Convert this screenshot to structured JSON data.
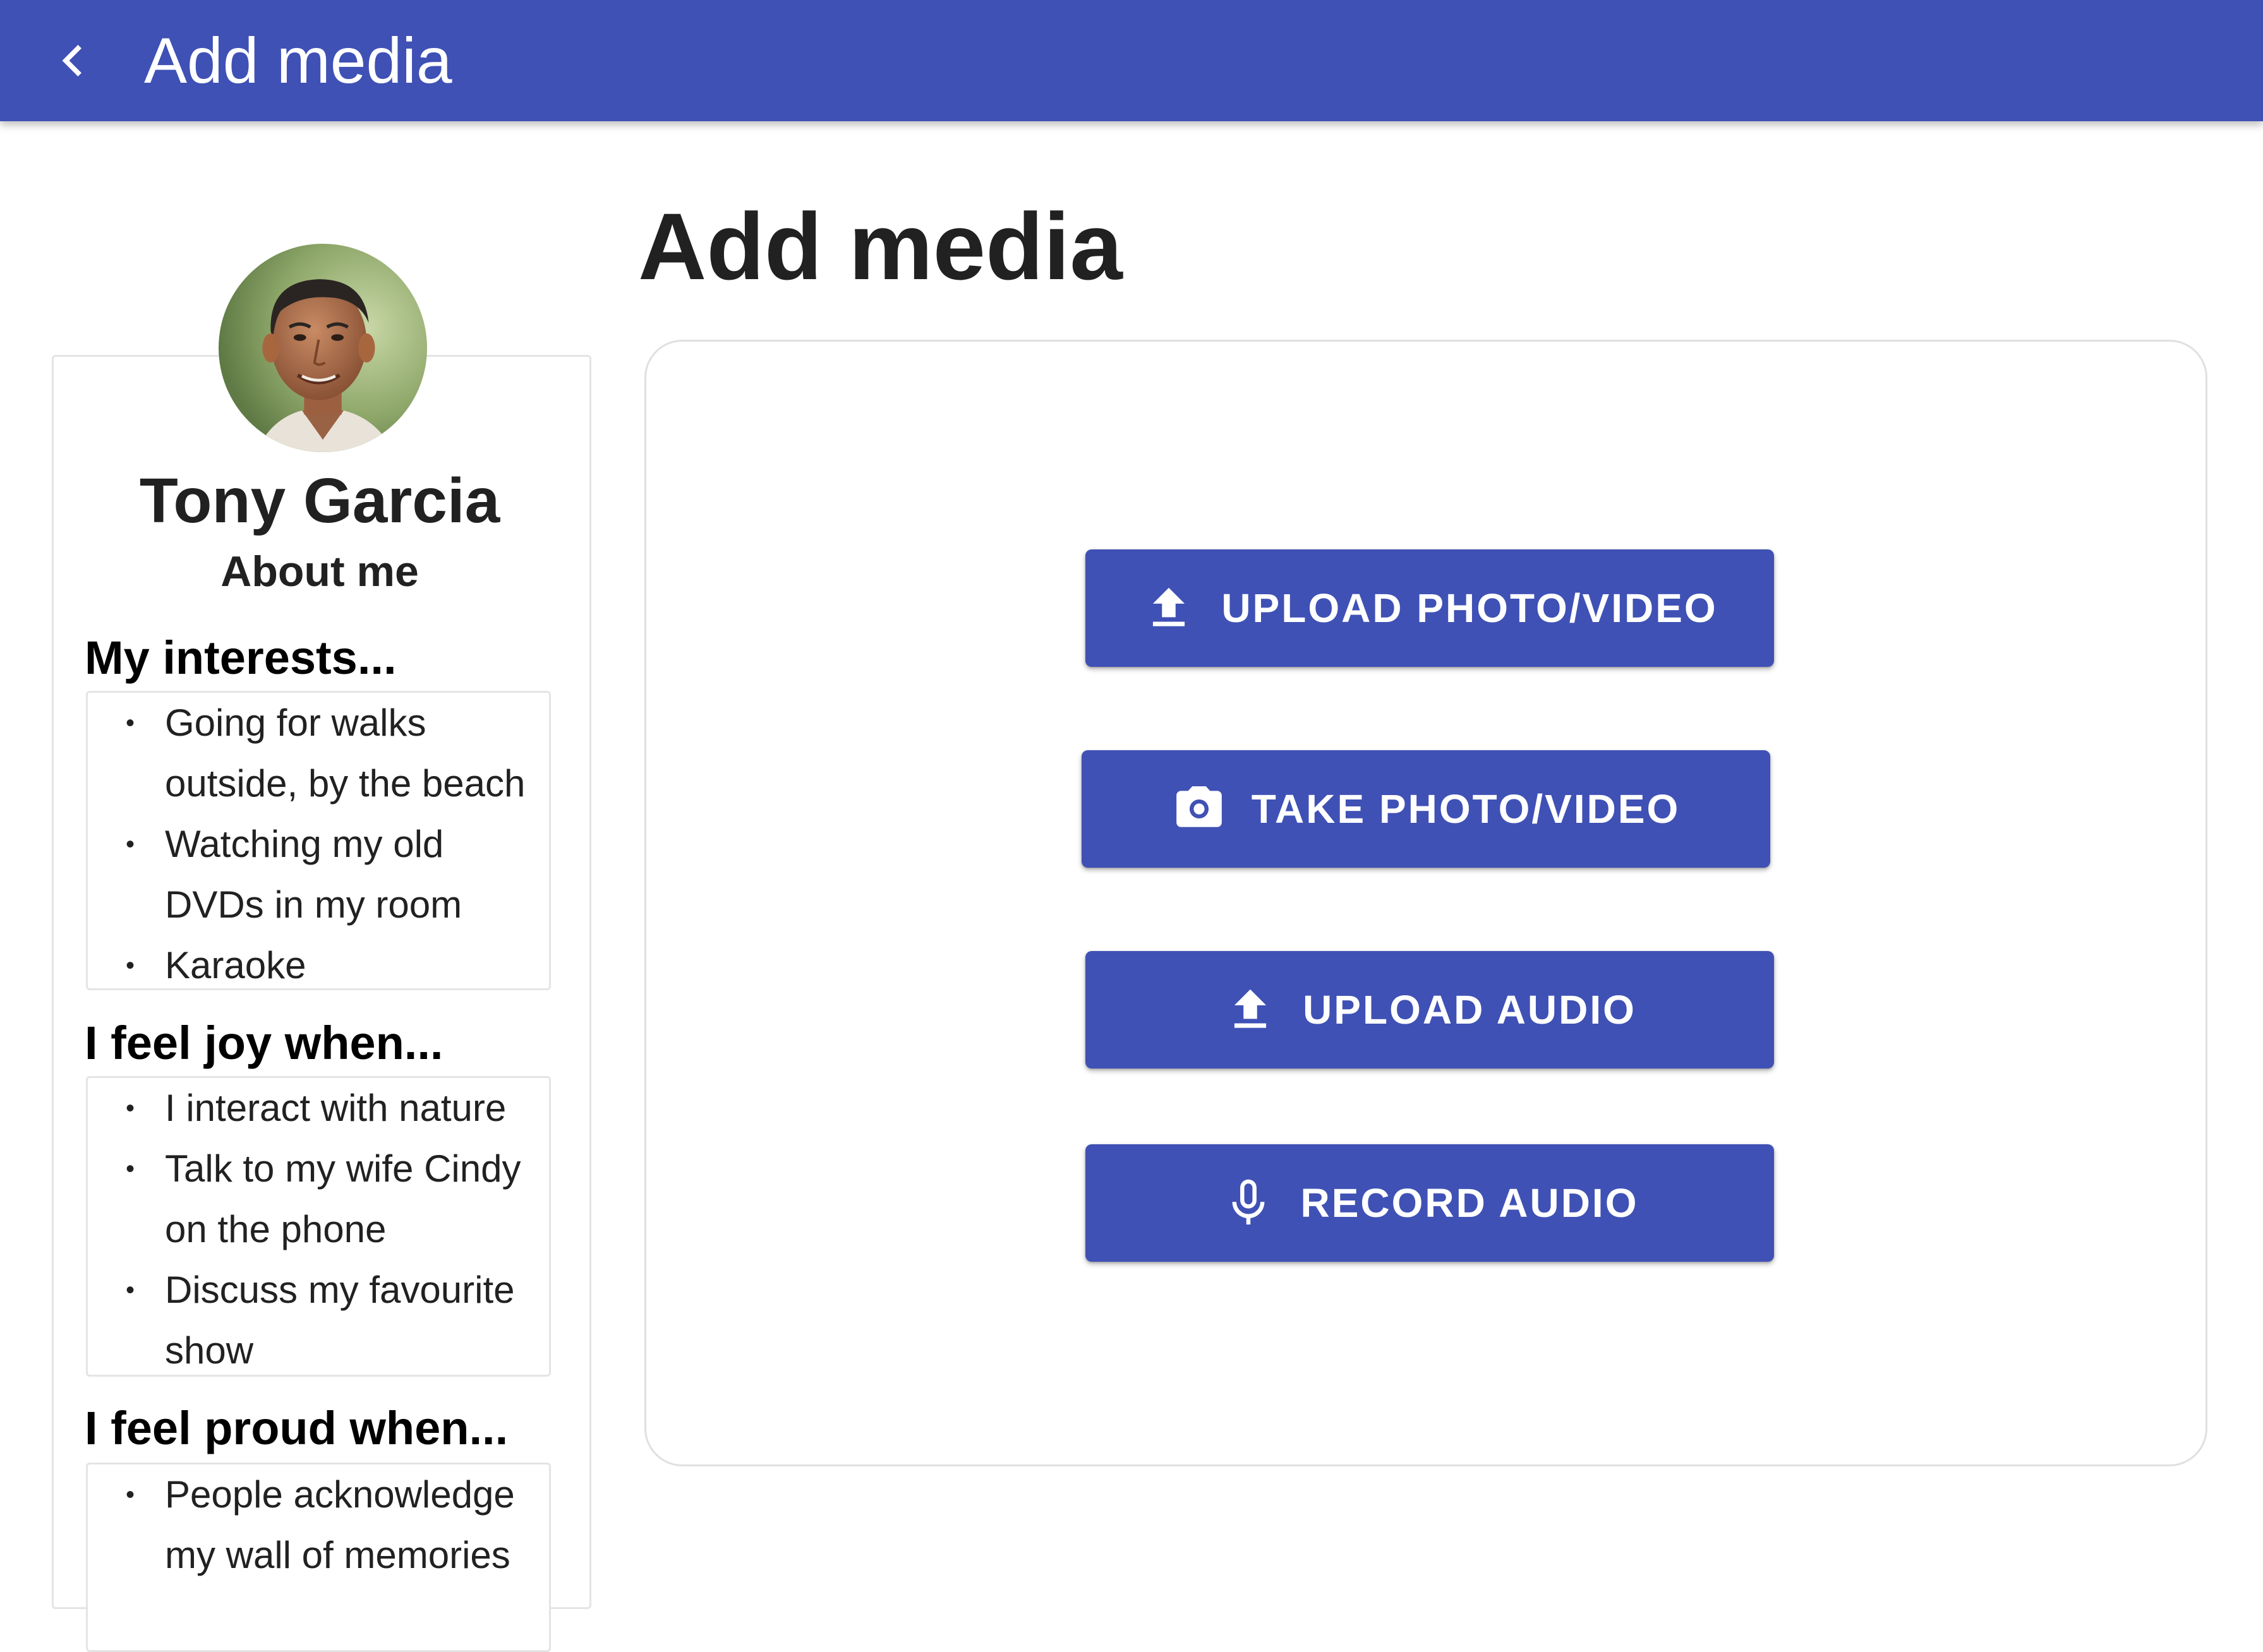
{
  "appbar": {
    "title": "Add media",
    "color": "#3f51b5",
    "back_icon": "chevron-left-icon"
  },
  "main": {
    "title": "Add media",
    "buttons": [
      {
        "label": "UPLOAD PHOTO/VIDEO",
        "icon": "upload-icon"
      },
      {
        "label": "TAKE PHOTO/VIDEO",
        "icon": "camera-icon"
      },
      {
        "label": "UPLOAD AUDIO",
        "icon": "upload-icon"
      },
      {
        "label": "RECORD AUDIO",
        "icon": "microphone-icon"
      }
    ]
  },
  "profile": {
    "name": "Tony Garcia",
    "about_title": "About me",
    "sections": [
      {
        "heading": "My interests...",
        "items": [
          "Going for walks outside, by the beach",
          "Watching my old DVDs in my room",
          "Karaoke"
        ]
      },
      {
        "heading": "I feel joy when...",
        "items": [
          "I interact with nature",
          "Talk to my wife Cindy on the phone",
          "Discuss my favourite show"
        ]
      },
      {
        "heading": "I feel proud when...",
        "items": [
          "People acknowledge my wall of memories"
        ]
      }
    ]
  }
}
